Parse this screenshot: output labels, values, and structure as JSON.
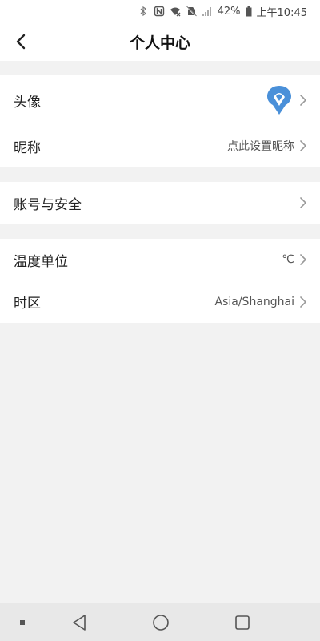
{
  "status_bar": {
    "battery_percent": "42%",
    "time": "上午10:45",
    "icons": [
      "bluetooth-icon",
      "nfc-icon",
      "wifi-icon",
      "no-sim-icon",
      "signal-icon",
      "battery-icon"
    ]
  },
  "header": {
    "title": "个人中心",
    "back_icon": "chevron-left-icon"
  },
  "profile_group": {
    "avatar_row": {
      "label": "头像",
      "avatar_icon": "brand-logo-icon",
      "accent": "#4a90d9"
    },
    "nickname_row": {
      "label": "昵称",
      "value": "点此设置昵称"
    }
  },
  "account_group": {
    "account_row": {
      "label": "账号与安全"
    }
  },
  "settings_group": {
    "temperature_row": {
      "label": "温度单位",
      "value": "℃"
    },
    "timezone_row": {
      "label": "时区",
      "value": "Asia/Shanghai"
    }
  },
  "nav_bar": {
    "items": [
      "menu-dot-icon",
      "back-triangle-icon",
      "home-circle-icon",
      "recents-square-icon"
    ]
  },
  "colors": {
    "background": "#f2f2f2",
    "card": "#ffffff",
    "accent": "#4a90d9",
    "chevron": "#999999"
  }
}
